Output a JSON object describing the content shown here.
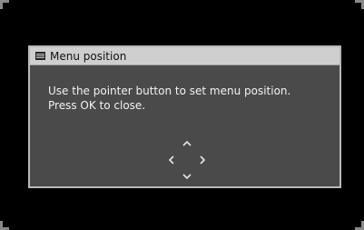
{
  "dialog": {
    "title": "Menu position",
    "message_line1": "Use the pointer button to set menu position.",
    "message_line2": "Press OK to close."
  },
  "icons": {
    "title": "menu-icon",
    "up": "chevron-up-icon",
    "down": "chevron-down-icon",
    "left": "chevron-left-icon",
    "right": "chevron-right-icon"
  },
  "colors": {
    "screen_background": "#000000",
    "dialog_background": "#4a4a4a",
    "titlebar_background": "#cfcfcf",
    "dialog_border": "#b9b9b9",
    "message_text": "#f2f2f2"
  }
}
